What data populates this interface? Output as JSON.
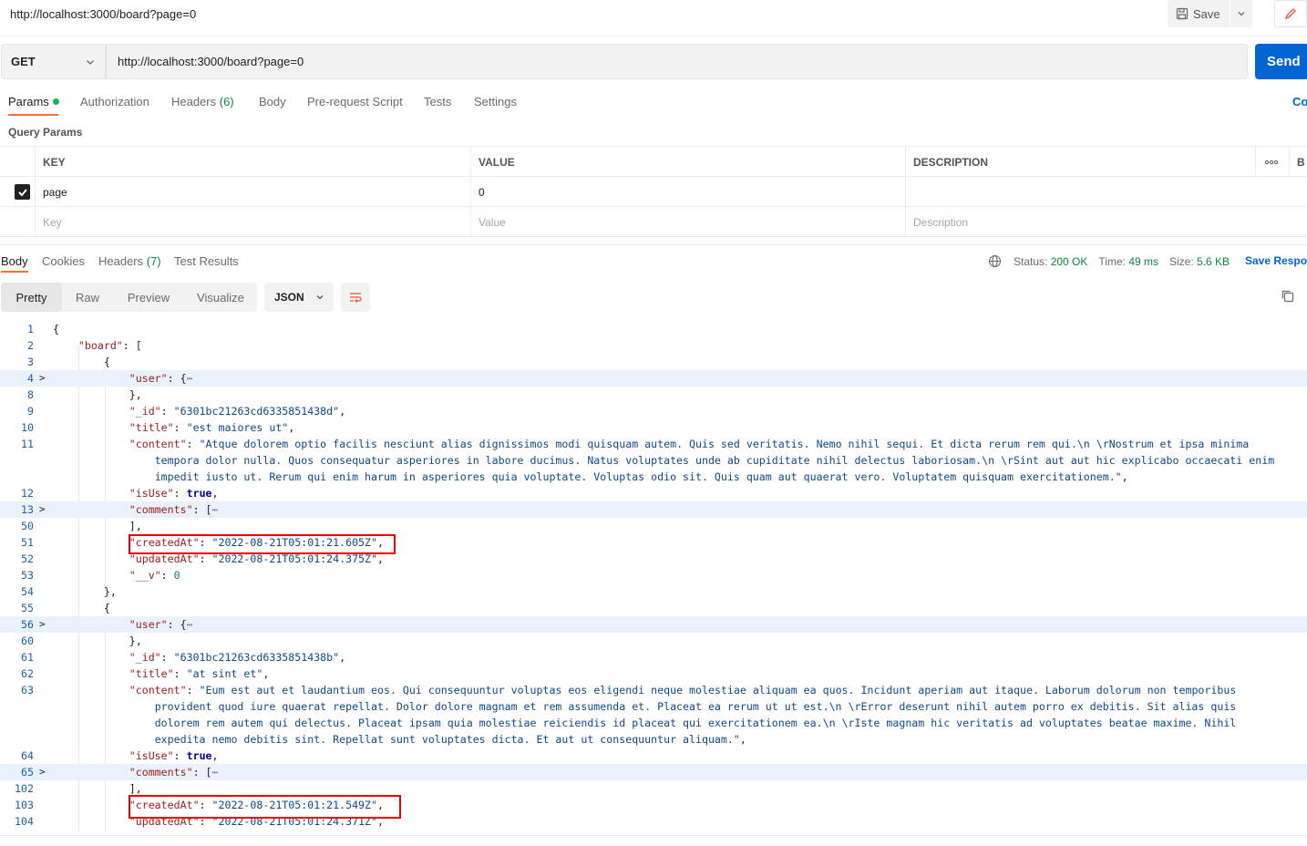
{
  "header": {
    "request_title": "http://localhost:3000/board?page=0",
    "save_label": "Save"
  },
  "request": {
    "method": "GET",
    "url": "http://localhost:3000/board?page=0",
    "send_label": "Send",
    "cookies_label": "Co"
  },
  "request_tabs": [
    {
      "label": "Params"
    },
    {
      "label": "Authorization"
    },
    {
      "label": "Headers ",
      "count": "(6)"
    },
    {
      "label": "Body"
    },
    {
      "label": "Pre-request Script"
    },
    {
      "label": "Tests"
    },
    {
      "label": "Settings"
    }
  ],
  "query_params": {
    "title": "Query Params",
    "headers": {
      "key": "KEY",
      "value": "VALUE",
      "description": "DESCRIPTION",
      "bulk": "B"
    },
    "rows": [
      {
        "key": "page",
        "value": "0",
        "checked": true
      }
    ],
    "placeholders": {
      "key": "Key",
      "value": "Value",
      "description": "Description"
    }
  },
  "response_tabs": [
    {
      "label": "Body"
    },
    {
      "label": "Cookies"
    },
    {
      "label": "Headers ",
      "count": "(7)"
    },
    {
      "label": "Test Results"
    }
  ],
  "response_status": {
    "status_label": "Status:",
    "status_value": "200 OK",
    "time_label": "Time:",
    "time_value": "49 ms",
    "size_label": "Size:",
    "size_value": "5.6 KB",
    "save_response": "Save Respo"
  },
  "body_views": [
    "Pretty",
    "Raw",
    "Preview",
    "Visualize"
  ],
  "format": "JSON",
  "code_lines": [
    {
      "n": "1"
    },
    {
      "n": "2"
    },
    {
      "n": "3"
    },
    {
      "n": "4"
    },
    {
      "n": "8"
    },
    {
      "n": "9"
    },
    {
      "n": "10"
    },
    {
      "n": "11"
    },
    {
      "n": ""
    },
    {
      "n": ""
    },
    {
      "n": "12"
    },
    {
      "n": "13"
    },
    {
      "n": "50"
    },
    {
      "n": "51"
    },
    {
      "n": "52"
    },
    {
      "n": "53"
    },
    {
      "n": "54"
    },
    {
      "n": "55"
    },
    {
      "n": "56"
    },
    {
      "n": "60"
    },
    {
      "n": "61"
    },
    {
      "n": "62"
    },
    {
      "n": "63"
    },
    {
      "n": ""
    },
    {
      "n": ""
    },
    {
      "n": ""
    },
    {
      "n": "64"
    },
    {
      "n": "65"
    },
    {
      "n": "102"
    },
    {
      "n": "103"
    },
    {
      "n": "104"
    }
  ],
  "json_body": {
    "id_1": "\"6301bc21263cd6335851438d\"",
    "title_1": "\"est maiores ut\"",
    "content_1a": "\"Atque dolorem optio facilis nesciunt alias dignissimos modi quisquam autem. Quis sed veritatis. Nemo nihil sequi. Et dicta rerum rem qui.\\n \\rNostrum et ipsa minima",
    "content_1b": "tempora dolor nulla. Quos consequatur asperiores in labore ducimus. Natus voluptates unde ab cupiditate nihil delectus laboriosam.\\n \\rSint aut aut hic explicabo occaecati enim",
    "content_1c": "impedit iusto ut. Rerum qui enim harum in asperiores quia voluptate. Voluptas odio sit. Quis quam aut quaerat vero. Voluptatem quisquam exercitationem.\"",
    "created_1": "\"2022-08-21T05:01:21.605Z\"",
    "updated_1": "\"2022-08-21T05:01:24.375Z\"",
    "v_1": "0",
    "id_2": "\"6301bc21263cd6335851438b\"",
    "title_2": "\"at sint et\"",
    "content_2a": "\"Eum est aut et laudantium eos. Qui consequuntur voluptas eos eligendi neque molestiae aliquam ea quos. Incidunt aperiam aut itaque. Laborum dolorum non temporibus",
    "content_2b": "provident quod iure quaerat repellat. Dolor dolore magnam et rem assumenda et. Placeat ea rerum ut ut est.\\n \\rError deserunt nihil autem porro ex debitis. Sit alias quis",
    "content_2c": "dolorem rem autem qui delectus. Placeat ipsam quia molestiae reiciendis id placeat qui exercitationem ea.\\n \\rIste magnam hic veritatis ad voluptates beatae maxime. Nihil",
    "content_2d": "expedita nemo debitis sint. Repellat sunt voluptates dicta. Et aut ut consequuntur aliquam.\"",
    "created_2": "\"2022-08-21T05:01:21.549Z\"",
    "updated_2": "\"2022-08-21T05:01:24.371Z\"",
    "true_val": "true",
    "k_board": "\"board\"",
    "k_user": "\"user\"",
    "k_id": "\"_id\"",
    "k_title": "\"title\"",
    "k_content": "\"content\"",
    "k_isUse": "\"isUse\"",
    "k_comments": "\"comments\"",
    "k_createdAt": "\"createdAt\"",
    "k_updatedAt": "\"updatedAt\"",
    "k_v": "\"__v\""
  }
}
